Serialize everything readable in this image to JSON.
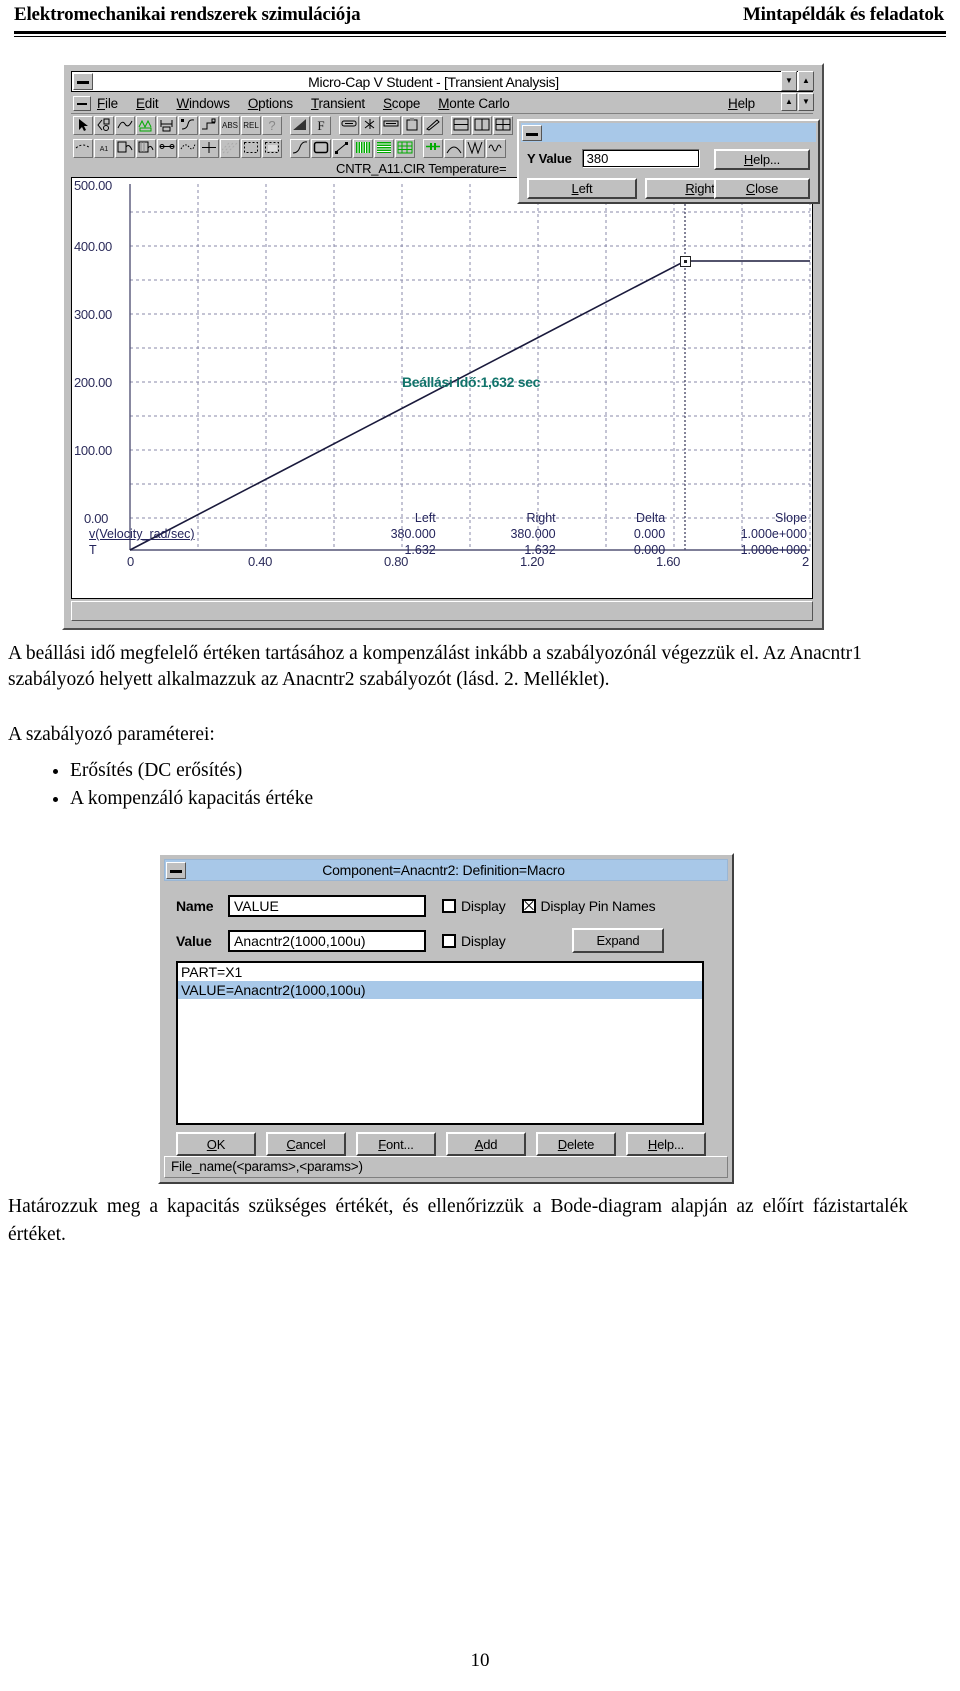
{
  "page": {
    "header_left": "Elektromechanikai rendszerek szimulációja",
    "header_right": "Mintapéldák és feladatok",
    "page_number": "10"
  },
  "microcap_window": {
    "title": "Micro-Cap V Student - [Transient Analysis]",
    "menu": [
      {
        "label": "File",
        "mnemonic": "F"
      },
      {
        "label": "Edit",
        "mnemonic": "E"
      },
      {
        "label": "Windows",
        "mnemonic": "W"
      },
      {
        "label": "Options",
        "mnemonic": "O"
      },
      {
        "label": "Transient",
        "mnemonic": "T"
      },
      {
        "label": "Scope",
        "mnemonic": "S"
      },
      {
        "label": "Monte Carlo",
        "mnemonic": "M"
      }
    ],
    "menu_help": "Help",
    "toolbar_text_buttons": [
      "ABS",
      "REL",
      "?",
      "F",
      "A1"
    ],
    "cir_label": "CNTR_A11.CIR Temperature=",
    "status_text": ""
  },
  "y_value_dialog": {
    "title": "",
    "field_label": "Y Value",
    "field_value": "380",
    "help_button": "Help...",
    "left_button": "Left",
    "right_button": "Right",
    "close_button": "Close"
  },
  "chart_data": {
    "type": "line",
    "title": "",
    "xlabel": "",
    "ylabel": "",
    "annotation": "Beállási idő:1,632 sec",
    "annotation_color": "#12746b",
    "x_ticks": [
      "0",
      "0.40",
      "0.80",
      "1.20",
      "1.60",
      "2"
    ],
    "x_tick_values": [
      0,
      0.4,
      0.8,
      1.2,
      1.6,
      2.0
    ],
    "y_ticks": [
      "500.00",
      "400.00",
      "300.00",
      "200.00",
      "100.00",
      "0.00"
    ],
    "y_tick_values": [
      500,
      400,
      300,
      200,
      100,
      0
    ],
    "xlim": [
      0,
      2.0
    ],
    "ylim": [
      0,
      500
    ],
    "grid": true,
    "series": [
      {
        "name": "v(Velocity_rad/sec)",
        "color": "#222244",
        "x": [
          0,
          0.1,
          0.2,
          0.3,
          0.4,
          0.5,
          0.6,
          0.7,
          0.8,
          0.9,
          1.0,
          1.1,
          1.2,
          1.3,
          1.4,
          1.5,
          1.6,
          1.632,
          1.7,
          1.8,
          1.9,
          2.0
        ],
        "y": [
          0,
          23,
          46,
          70,
          93,
          116,
          139,
          163,
          186,
          209,
          232,
          256,
          279,
          302,
          325,
          349,
          372,
          380,
          380,
          380,
          380,
          380
        ]
      }
    ],
    "cursor": {
      "x": 1.632,
      "y": 380
    }
  },
  "readout": {
    "headers": [
      "",
      "Left",
      "Right",
      "Delta",
      "Slope"
    ],
    "rows": [
      {
        "name": "v(Velocity_rad/sec)",
        "left": "380.000",
        "right": "380.000",
        "delta": "0.000",
        "slope": "1.000e+000"
      },
      {
        "name": "T",
        "left": "1.632",
        "right": "1.632",
        "delta": "0.000",
        "slope": "1.000e+000"
      }
    ]
  },
  "text": {
    "paragraph1": "A beállási idő megfelelő értéken tartásához a kompenzálást inkább a szabályozónál végezzük el. Az Anacntr1 szabályozó helyett alkalmazzuk az Anacntr2 szabályozót (lásd. 2. Melléklet).",
    "paragraph2": "A szabályozó paraméterei:",
    "bullets": [
      "Erősítés (DC erősítés)",
      "A kompenzáló kapacitás értéke"
    ],
    "paragraph3": "Határozzuk meg a kapacitás szükséges értékét, és ellenőrizzük a Bode-diagram alapján az előírt fázistartalék értéket."
  },
  "component_dialog": {
    "title": "Component=Anacntr2: Definition=Macro",
    "name_label": "Name",
    "name_value": "VALUE",
    "name_display_label": "Display",
    "name_display_checked": false,
    "display_pin_names_label": "Display Pin Names",
    "display_pin_names_checked": true,
    "value_label": "Value",
    "value_value": "Anacntr2(1000,100u)",
    "value_display_label": "Display",
    "value_display_checked": false,
    "expand_button": "Expand",
    "textarea_lines": [
      {
        "text": "PART=X1",
        "selected": false
      },
      {
        "text": "VALUE=Anacntr2(1000,100u)",
        "selected": true
      }
    ],
    "buttons": [
      {
        "label": "OK",
        "mnemonic": "O"
      },
      {
        "label": "Cancel",
        "mnemonic": "C"
      },
      {
        "label": "Font...",
        "mnemonic": "F"
      },
      {
        "label": "Add",
        "mnemonic": "A"
      },
      {
        "label": "Delete",
        "mnemonic": "D"
      },
      {
        "label": "Help...",
        "mnemonic": "H"
      }
    ],
    "footer": "File_name(<params>,<params>)"
  }
}
